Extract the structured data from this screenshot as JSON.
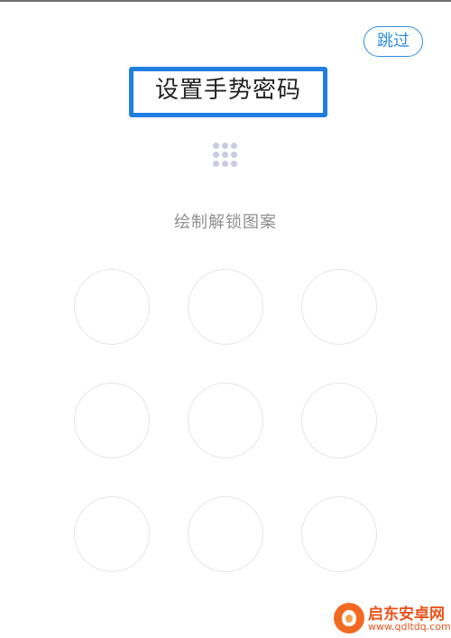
{
  "header": {
    "skip_label": "跳过",
    "title": "设置手势密码"
  },
  "hint": "绘制解锁图案",
  "pattern": {
    "rows": 3,
    "cols": 3,
    "preview_icon": "nine-dot-grid-icon"
  },
  "colors": {
    "accent": "#2f8fe3",
    "highlight_frame": "#1f7fe0",
    "preview_dots": "#c8cbe6",
    "node_border": "#e6e6e6",
    "hint_text": "#8f8f8f"
  },
  "watermark": {
    "name": "启东安卓网",
    "url": "www.qdltdq.com"
  }
}
